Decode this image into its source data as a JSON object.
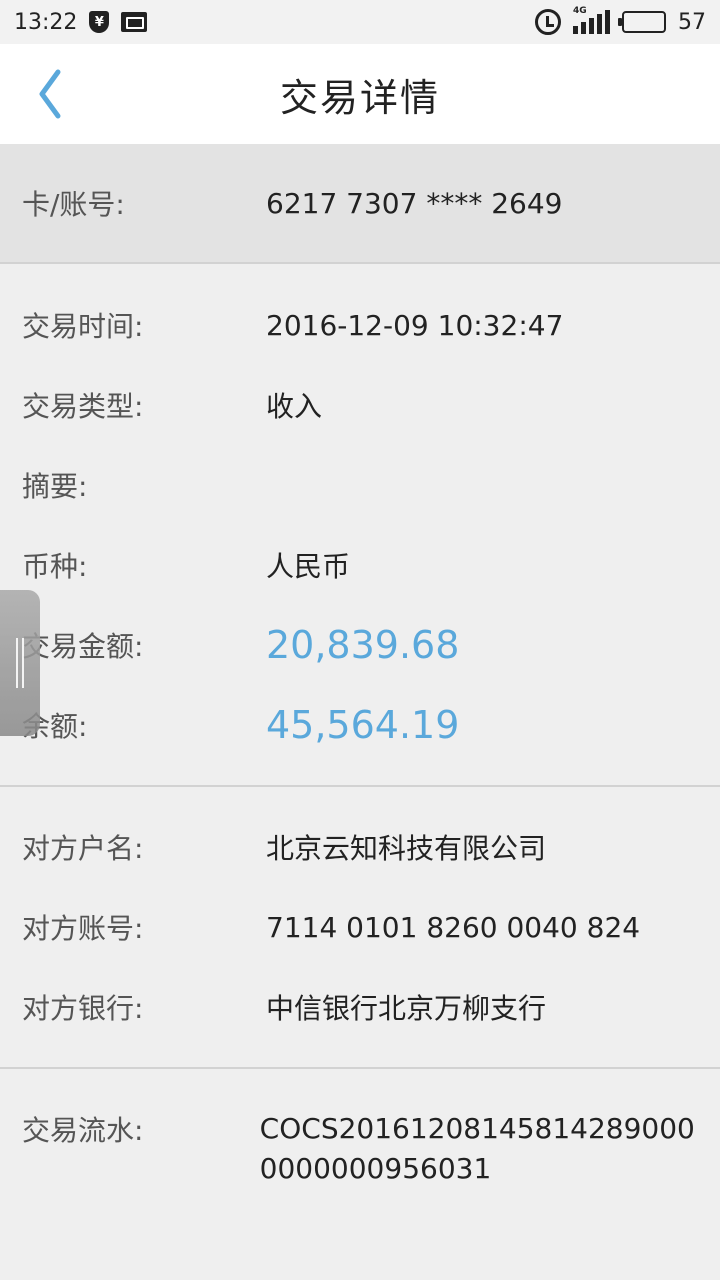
{
  "status_bar": {
    "time": "13:22",
    "battery_level": "57",
    "network_tag": "4G"
  },
  "header": {
    "title": "交易详情"
  },
  "card": {
    "label": "卡/账号:",
    "value": "6217 7307 **** 2649"
  },
  "transaction": {
    "time_label": "交易时间:",
    "time_value": "2016-12-09 10:32:47",
    "type_label": "交易类型:",
    "type_value": "收入",
    "summary_label": "摘要:",
    "summary_value": "",
    "currency_label": "币种:",
    "currency_value": "人民币",
    "amount_label": "交易金额:",
    "amount_value": "20,839.68",
    "balance_label": "余额:",
    "balance_value": "45,564.19"
  },
  "counterparty": {
    "name_label": "对方户名:",
    "name_value": "北京云知科技有限公司",
    "account_label": "对方账号:",
    "account_value": "7114 0101 8260 0040 824",
    "bank_label": "对方银行:",
    "bank_value": "中信银行北京万柳支行"
  },
  "serial": {
    "label": "交易流水:",
    "value": "COCS201612081458142890000000000956031"
  },
  "colors": {
    "accent": "#5aa8db",
    "background": "#efefef",
    "card_background": "#e3e3e3"
  }
}
